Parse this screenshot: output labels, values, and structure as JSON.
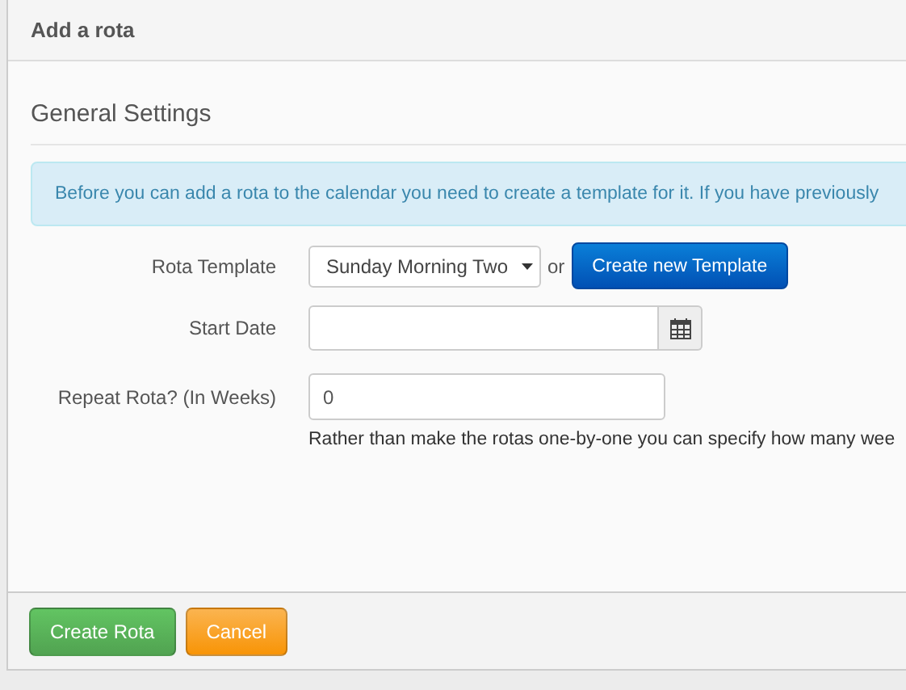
{
  "panel": {
    "title": "Add a rota"
  },
  "section": {
    "title": "General Settings"
  },
  "info": "Before you can add a rota to the calendar you need to create a template for it. If you have previously",
  "form": {
    "template": {
      "label": "Rota Template",
      "value": "Sunday Morning Two",
      "or": "or",
      "button": "Create new Template"
    },
    "start_date": {
      "label": "Start Date"
    },
    "repeat": {
      "label": "Repeat Rota? (In Weeks)",
      "value": "0",
      "help": "Rather than make the rotas one-by-one you can specify how many wee"
    }
  },
  "buttons": [
    {
      "label": "Create Rota",
      "kind": "success"
    },
    {
      "label": "Cancel",
      "kind": "warning"
    }
  ]
}
